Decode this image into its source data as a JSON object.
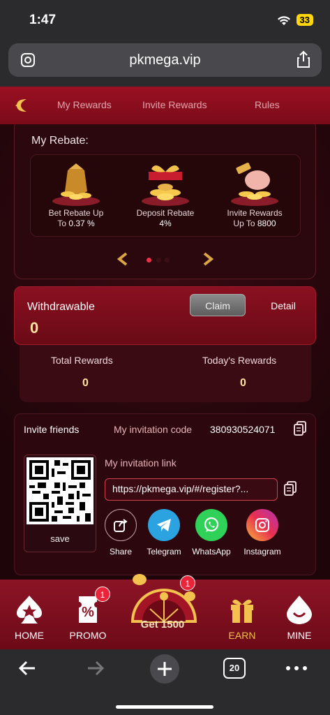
{
  "status_bar": {
    "time": "1:47",
    "battery": "33"
  },
  "browser": {
    "url": "pkmega.vip",
    "tab_count": "20"
  },
  "app_tabs": [
    "My Rewards",
    "Invite Rewards",
    "Rules"
  ],
  "rebate": {
    "title": "My Rebate:",
    "items": [
      {
        "label": "Bet Rebate Up",
        "value_prefix": "To ",
        "value": "0.37 %"
      },
      {
        "label": "Deposit Rebate",
        "value_prefix": "",
        "value": "4%"
      },
      {
        "label": "Invite Rewards",
        "value_prefix": "Up To ",
        "value": "8800"
      }
    ]
  },
  "withdraw": {
    "label": "Withdrawable",
    "value": "0",
    "claim": "Claim",
    "detail": "Detail"
  },
  "totals": {
    "total_label": "Total Rewards",
    "total_value": "0",
    "today_label": "Today's Rewards",
    "today_value": "0"
  },
  "invite": {
    "title": "Invite friends",
    "code_label": "My invitation code",
    "code": "380930524071",
    "link_label": "My invitation link",
    "link": "https://pkmega.vip/#/register?...",
    "save": "save",
    "share": [
      "Share",
      "Telegram",
      "WhatsApp",
      "Instagram"
    ]
  },
  "bottom_nav": {
    "home": "HOME",
    "promo": "PROMO",
    "promo_badge": "1",
    "center": "Get 1500",
    "center_badge": "1",
    "earn": "EARN",
    "mine": "MINE"
  }
}
